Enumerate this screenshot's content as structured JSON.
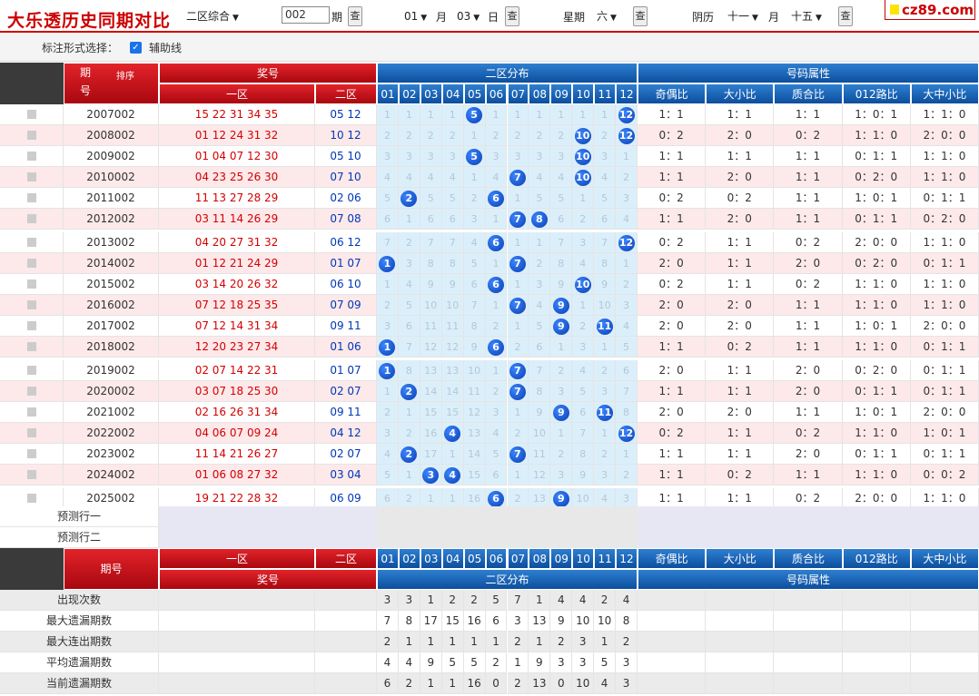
{
  "topbar": {
    "title": "大乐透历史同期对比",
    "zone_select": "二区综合",
    "period_value": "002",
    "period_label": "期",
    "query_btn": "查",
    "month_value": "01",
    "month_label": "月",
    "day_value": "03",
    "day_label": "日",
    "week_label": "星期",
    "week_value": "六",
    "lunar_label": "阴历",
    "lunar_month": "十一",
    "lunar_month_label": "月",
    "lunar_day": "十五",
    "logo": "cz89.com"
  },
  "options": {
    "label": "标注形式选择：",
    "check_label": "辅助线",
    "checked": true
  },
  "header": {
    "period": "期",
    "period2": "号",
    "sort": "排序",
    "award": "奖号",
    "zone1": "一区",
    "zone2": "二区",
    "dist": "二区分布",
    "attr": "号码属性",
    "attrs": [
      "奇偶比",
      "大小比",
      "质合比",
      "012路比",
      "大中小比"
    ],
    "cols": [
      "01",
      "02",
      "03",
      "04",
      "05",
      "06",
      "07",
      "08",
      "09",
      "10",
      "11",
      "12"
    ]
  },
  "rows": [
    {
      "period": "2007002",
      "front": "15 22 31 34 35",
      "back": "05 12",
      "dist": [
        "1",
        "1",
        "1",
        "1",
        "5",
        "1",
        "1",
        "1",
        "1",
        "1",
        "1",
        "12"
      ],
      "attrs": [
        "1：1",
        "1：1",
        "1：1",
        "1：0：1",
        "1：1：0"
      ]
    },
    {
      "period": "2008002",
      "front": "01 12 24 31 32",
      "back": "10 12",
      "dist": [
        "2",
        "2",
        "2",
        "2",
        "1",
        "2",
        "2",
        "2",
        "2",
        "10",
        "2",
        "12"
      ],
      "attrs": [
        "0：2",
        "2：0",
        "0：2",
        "1：1：0",
        "2：0：0"
      ]
    },
    {
      "period": "2009002",
      "front": "01 04 07 12 30",
      "back": "05 10",
      "dist": [
        "3",
        "3",
        "3",
        "3",
        "5",
        "3",
        "3",
        "3",
        "3",
        "10",
        "3",
        "1"
      ],
      "attrs": [
        "1：1",
        "1：1",
        "1：1",
        "0：1：1",
        "1：1：0"
      ]
    },
    {
      "period": "2010002",
      "front": "04 23 25 26 30",
      "back": "07 10",
      "dist": [
        "4",
        "4",
        "4",
        "4",
        "1",
        "4",
        "7",
        "4",
        "4",
        "10",
        "4",
        "2"
      ],
      "attrs": [
        "1：1",
        "2：0",
        "1：1",
        "0：2：0",
        "1：1：0"
      ]
    },
    {
      "period": "2011002",
      "front": "11 13 27 28 29",
      "back": "02 06",
      "dist": [
        "5",
        "2",
        "5",
        "5",
        "2",
        "6",
        "1",
        "5",
        "5",
        "1",
        "5",
        "3"
      ],
      "attrs": [
        "0：2",
        "0：2",
        "1：1",
        "1：0：1",
        "0：1：1"
      ]
    },
    {
      "period": "2012002",
      "front": "03 11 14 26 29",
      "back": "07 08",
      "dist": [
        "6",
        "1",
        "6",
        "6",
        "3",
        "1",
        "7",
        "8",
        "6",
        "2",
        "6",
        "4"
      ],
      "attrs": [
        "1：1",
        "2：0",
        "1：1",
        "0：1：1",
        "0：2：0"
      ]
    },
    {
      "period": "2013002",
      "front": "04 20 27 31 32",
      "back": "06 12",
      "dist": [
        "7",
        "2",
        "7",
        "7",
        "4",
        "6",
        "1",
        "1",
        "7",
        "3",
        "7",
        "12"
      ],
      "attrs": [
        "0：2",
        "1：1",
        "0：2",
        "2：0：0",
        "1：1：0"
      ]
    },
    {
      "period": "2014002",
      "front": "01 12 21 24 29",
      "back": "01 07",
      "dist": [
        "1",
        "3",
        "8",
        "8",
        "5",
        "1",
        "7",
        "2",
        "8",
        "4",
        "8",
        "1"
      ],
      "attrs": [
        "2：0",
        "1：1",
        "2：0",
        "0：2：0",
        "0：1：1"
      ]
    },
    {
      "period": "2015002",
      "front": "03 14 20 26 32",
      "back": "06 10",
      "dist": [
        "1",
        "4",
        "9",
        "9",
        "6",
        "6",
        "1",
        "3",
        "9",
        "10",
        "9",
        "2"
      ],
      "attrs": [
        "0：2",
        "1：1",
        "0：2",
        "1：1：0",
        "1：1：0"
      ]
    },
    {
      "period": "2016002",
      "front": "07 12 18 25 35",
      "back": "07 09",
      "dist": [
        "2",
        "5",
        "10",
        "10",
        "7",
        "1",
        "7",
        "4",
        "9",
        "1",
        "10",
        "3"
      ],
      "attrs": [
        "2：0",
        "2：0",
        "1：1",
        "1：1：0",
        "1：1：0"
      ]
    },
    {
      "period": "2017002",
      "front": "07 12 14 31 34",
      "back": "09 11",
      "dist": [
        "3",
        "6",
        "11",
        "11",
        "8",
        "2",
        "1",
        "5",
        "9",
        "2",
        "11",
        "4"
      ],
      "attrs": [
        "2：0",
        "2：0",
        "1：1",
        "1：0：1",
        "2：0：0"
      ]
    },
    {
      "period": "2018002",
      "front": "12 20 23 27 34",
      "back": "01 06",
      "dist": [
        "1",
        "7",
        "12",
        "12",
        "9",
        "6",
        "2",
        "6",
        "1",
        "3",
        "1",
        "5"
      ],
      "attrs": [
        "1：1",
        "0：2",
        "1：1",
        "1：1：0",
        "0：1：1"
      ]
    },
    {
      "period": "2019002",
      "front": "02 07 14 22 31",
      "back": "01 07",
      "dist": [
        "1",
        "8",
        "13",
        "13",
        "10",
        "1",
        "7",
        "7",
        "2",
        "4",
        "2",
        "6"
      ],
      "attrs": [
        "2：0",
        "1：1",
        "2：0",
        "0：2：0",
        "0：1：1"
      ]
    },
    {
      "period": "2020002",
      "front": "03 07 18 25 30",
      "back": "02 07",
      "dist": [
        "1",
        "2",
        "14",
        "14",
        "11",
        "2",
        "7",
        "8",
        "3",
        "5",
        "3",
        "7"
      ],
      "attrs": [
        "1：1",
        "1：1",
        "2：0",
        "0：1：1",
        "0：1：1"
      ]
    },
    {
      "period": "2021002",
      "front": "02 16 26 31 34",
      "back": "09 11",
      "dist": [
        "2",
        "1",
        "15",
        "15",
        "12",
        "3",
        "1",
        "9",
        "9",
        "6",
        "11",
        "8"
      ],
      "attrs": [
        "2：0",
        "2：0",
        "1：1",
        "1：0：1",
        "2：0：0"
      ]
    },
    {
      "period": "2022002",
      "front": "04 06 07 09 24",
      "back": "04 12",
      "dist": [
        "3",
        "2",
        "16",
        "4",
        "13",
        "4",
        "2",
        "10",
        "1",
        "7",
        "1",
        "12"
      ],
      "attrs": [
        "0：2",
        "1：1",
        "0：2",
        "1：1：0",
        "1：0：1"
      ]
    },
    {
      "period": "2023002",
      "front": "11 14 21 26 27",
      "back": "02 07",
      "dist": [
        "4",
        "2",
        "17",
        "1",
        "14",
        "5",
        "7",
        "11",
        "2",
        "8",
        "2",
        "1"
      ],
      "attrs": [
        "1：1",
        "1：1",
        "2：0",
        "0：1：1",
        "0：1：1"
      ]
    },
    {
      "period": "2024002",
      "front": "01 06 08 27 32",
      "back": "03 04",
      "dist": [
        "5",
        "1",
        "3",
        "4",
        "15",
        "6",
        "1",
        "12",
        "3",
        "9",
        "3",
        "2"
      ],
      "attrs": [
        "1：1",
        "0：2",
        "1：1",
        "1：1：0",
        "0：0：2"
      ]
    },
    {
      "period": "2025002",
      "front": "19 21 22 28 32",
      "back": "06 09",
      "dist": [
        "6",
        "2",
        "1",
        "1",
        "16",
        "6",
        "2",
        "13",
        "9",
        "10",
        "4",
        "3"
      ],
      "attrs": [
        "1：1",
        "1：1",
        "0：2",
        "2：0：0",
        "1：1：0"
      ]
    }
  ],
  "predict": [
    "预测行一",
    "预测行二"
  ],
  "footer_header": {
    "period": "期号",
    "zone1": "一区",
    "zone2": "二区",
    "award": "奖号",
    "dist": "二区分布",
    "attr": "号码属性"
  },
  "stats": [
    {
      "label": "出现次数",
      "values": [
        "3",
        "3",
        "1",
        "2",
        "2",
        "5",
        "7",
        "1",
        "4",
        "4",
        "2",
        "4"
      ]
    },
    {
      "label": "最大遗漏期数",
      "values": [
        "7",
        "8",
        "17",
        "15",
        "16",
        "6",
        "3",
        "13",
        "9",
        "10",
        "10",
        "8"
      ]
    },
    {
      "label": "最大连出期数",
      "values": [
        "2",
        "1",
        "1",
        "1",
        "1",
        "1",
        "2",
        "1",
        "2",
        "3",
        "1",
        "2"
      ]
    },
    {
      "label": "平均遗漏期数",
      "values": [
        "4",
        "4",
        "9",
        "5",
        "5",
        "2",
        "1",
        "9",
        "3",
        "3",
        "5",
        "3"
      ]
    },
    {
      "label": "当前遗漏期数",
      "values": [
        "6",
        "2",
        "1",
        "1",
        "16",
        "0",
        "2",
        "13",
        "0",
        "10",
        "4",
        "3"
      ]
    }
  ]
}
